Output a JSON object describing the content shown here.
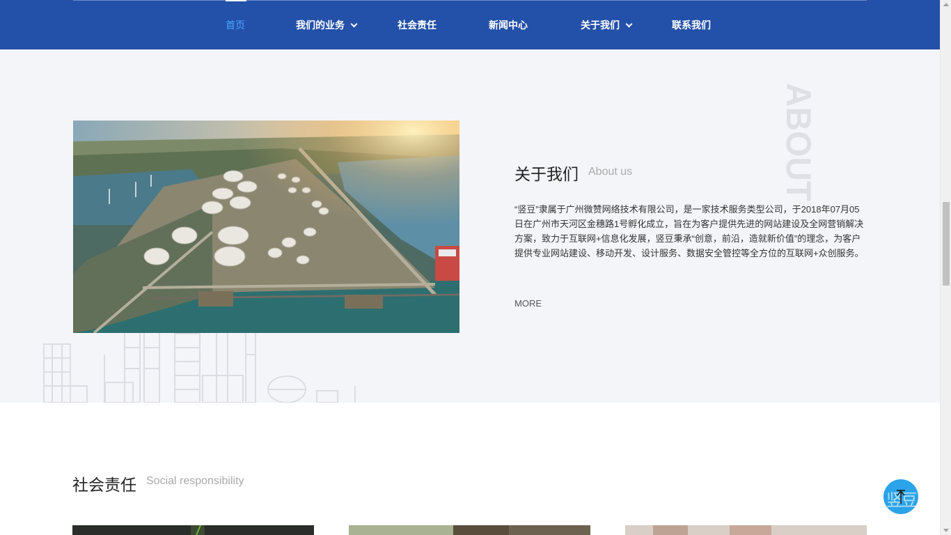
{
  "nav": {
    "items": [
      {
        "label": "首页",
        "active": true,
        "dropdown": false
      },
      {
        "label": "我们的业务",
        "active": false,
        "dropdown": true
      },
      {
        "label": "社会责任",
        "active": false,
        "dropdown": false
      },
      {
        "label": "新闻中心",
        "active": false,
        "dropdown": false
      },
      {
        "label": "关于我们",
        "active": false,
        "dropdown": true
      },
      {
        "label": "联系我们",
        "active": false,
        "dropdown": false
      }
    ]
  },
  "about": {
    "title": "关于我们",
    "subtitle": "About us",
    "watermark": "ABOUT",
    "text": "“竖豆”隶属于广州微赞网络技术有限公司，是一家技术服务类型公司，于2018年07月05日在广州市天河区金穗路1号孵化成立，旨在为客户提供先进的网站建设及全网营销解决方案，致力于互联网+信息化发展，竖豆秉承“创意，前沿，造就新价值”的理念，为客户提供专业网站建设、移动开发、设计服务、数据安全管控等全方位的互联网+众创服务。",
    "more": "MORE"
  },
  "social": {
    "title": "社会责任",
    "subtitle": "Social responsibility"
  },
  "float_button": {
    "logo_text": "竖豆",
    "icon": "arrow-up-icon"
  },
  "colors": {
    "nav_bg": "#2350a8",
    "nav_active": "#4aa8ff",
    "about_bg": "#f4f5f9",
    "float_btn": "#2ba3e9"
  }
}
